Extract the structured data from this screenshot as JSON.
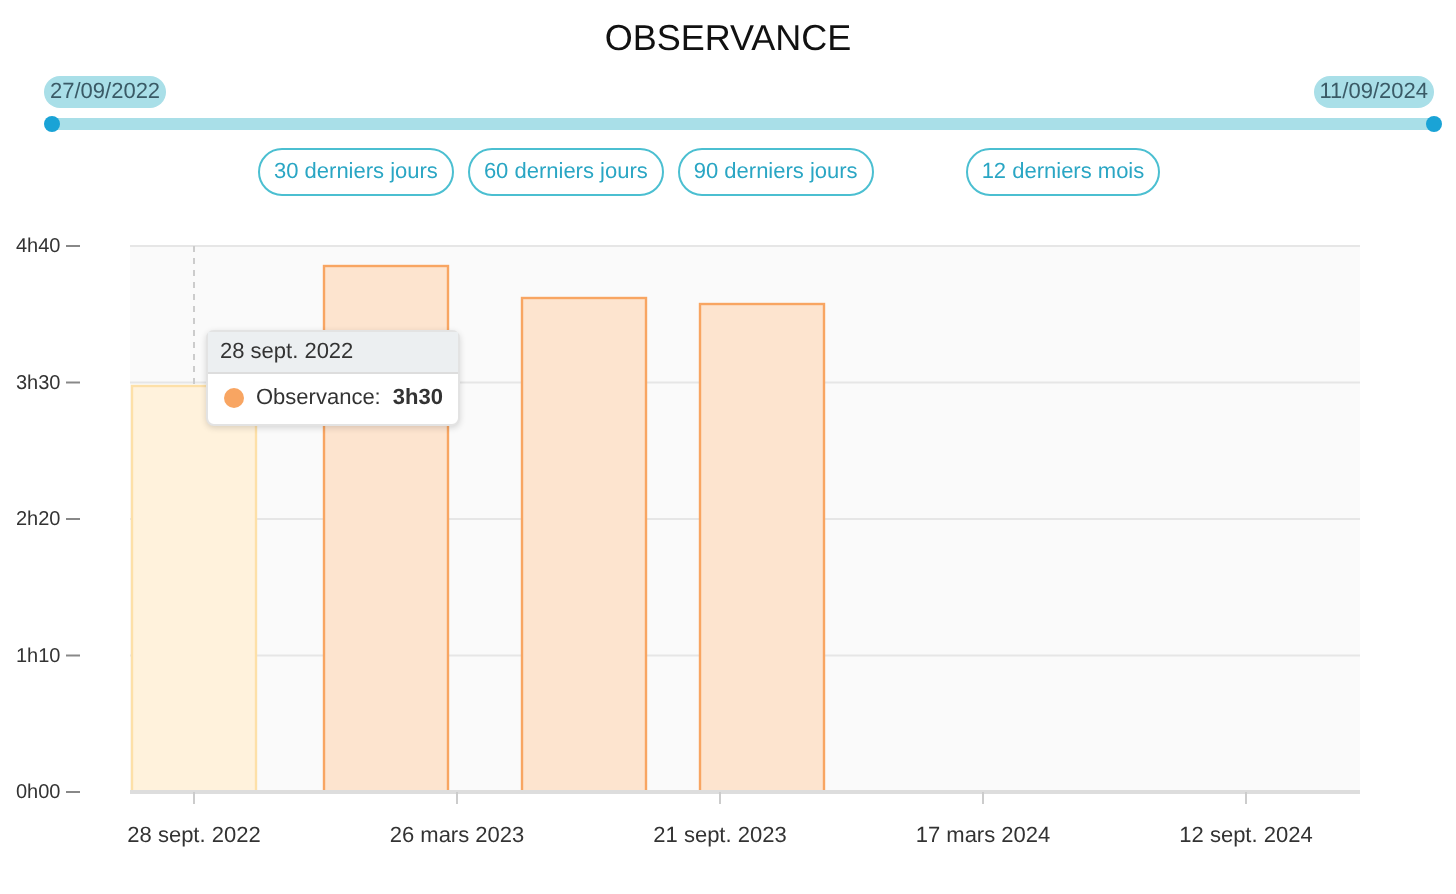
{
  "title": "OBSERVANCE",
  "range": {
    "start": "27/09/2022",
    "end": "11/09/2024"
  },
  "presets": [
    {
      "label": "30 derniers jours",
      "selected": false
    },
    {
      "label": "60 derniers jours",
      "selected": false
    },
    {
      "label": "90 derniers jours",
      "selected": false
    },
    {
      "label": "12 derniers mois",
      "selected": false
    }
  ],
  "chart": {
    "y_labels": [
      "4h40",
      "3h30",
      "2h20",
      "1h10",
      "0h00"
    ],
    "x_labels": [
      "28 sept. 2022",
      "26 mars 2023",
      "21 sept. 2023",
      "17 mars 2024",
      "12 sept. 2024"
    ],
    "bars": [
      {
        "selected": true
      },
      {
        "selected": false
      },
      {
        "selected": false
      },
      {
        "selected": false
      }
    ],
    "tooltip": {
      "date": "28 sept. 2022",
      "label": "Observance:",
      "value": "3h30",
      "color": "#f8a562"
    }
  }
}
